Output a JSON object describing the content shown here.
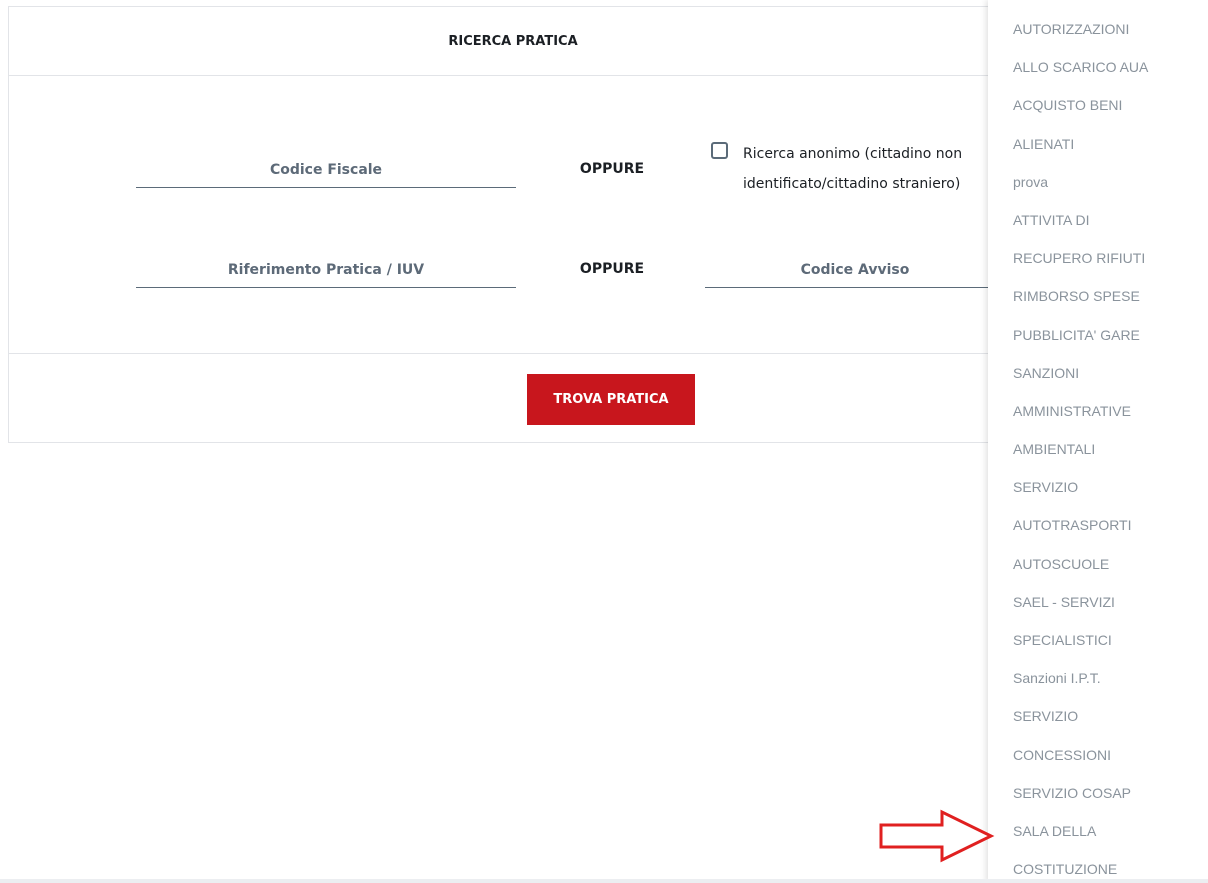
{
  "form": {
    "title": "RICERCA PRATICA",
    "codice_fiscale_placeholder": "Codice Fiscale",
    "oppure_1": "OPPURE",
    "anon_label": "Ricerca anonimo (cittadino non identificato/cittadino straniero)",
    "riferimento_placeholder": "Riferimento Pratica / IUV",
    "oppure_2": "OPPURE",
    "codice_avviso_placeholder": "Codice Avviso",
    "trova_button": "TROVA PRATICA",
    "accent_color": "#c8161d"
  },
  "dropdown": {
    "items": [
      "AUTORIZZAZIONI",
      "ALLO SCARICO AUA",
      "ACQUISTO BENI",
      "ALIENATI",
      "prova",
      "ATTIVITA DI",
      "RECUPERO RIFIUTI",
      "RIMBORSO SPESE",
      "PUBBLICITA' GARE",
      "SANZIONI",
      "AMMINISTRATIVE",
      "AMBIENTALI",
      "SERVIZIO",
      "AUTOTRASPORTI",
      "AUTOSCUOLE",
      "SAEL - SERVIZI",
      "SPECIALISTICI",
      "Sanzioni I.P.T.",
      "SERVIZIO",
      "CONCESSIONI",
      "SERVIZIO COSAP",
      "SALA DELLA",
      "COSTITUZIONE"
    ]
  },
  "annotation": {
    "arrow_icon": "right-arrow-outline-icon",
    "arrow_color": "#e02020"
  }
}
